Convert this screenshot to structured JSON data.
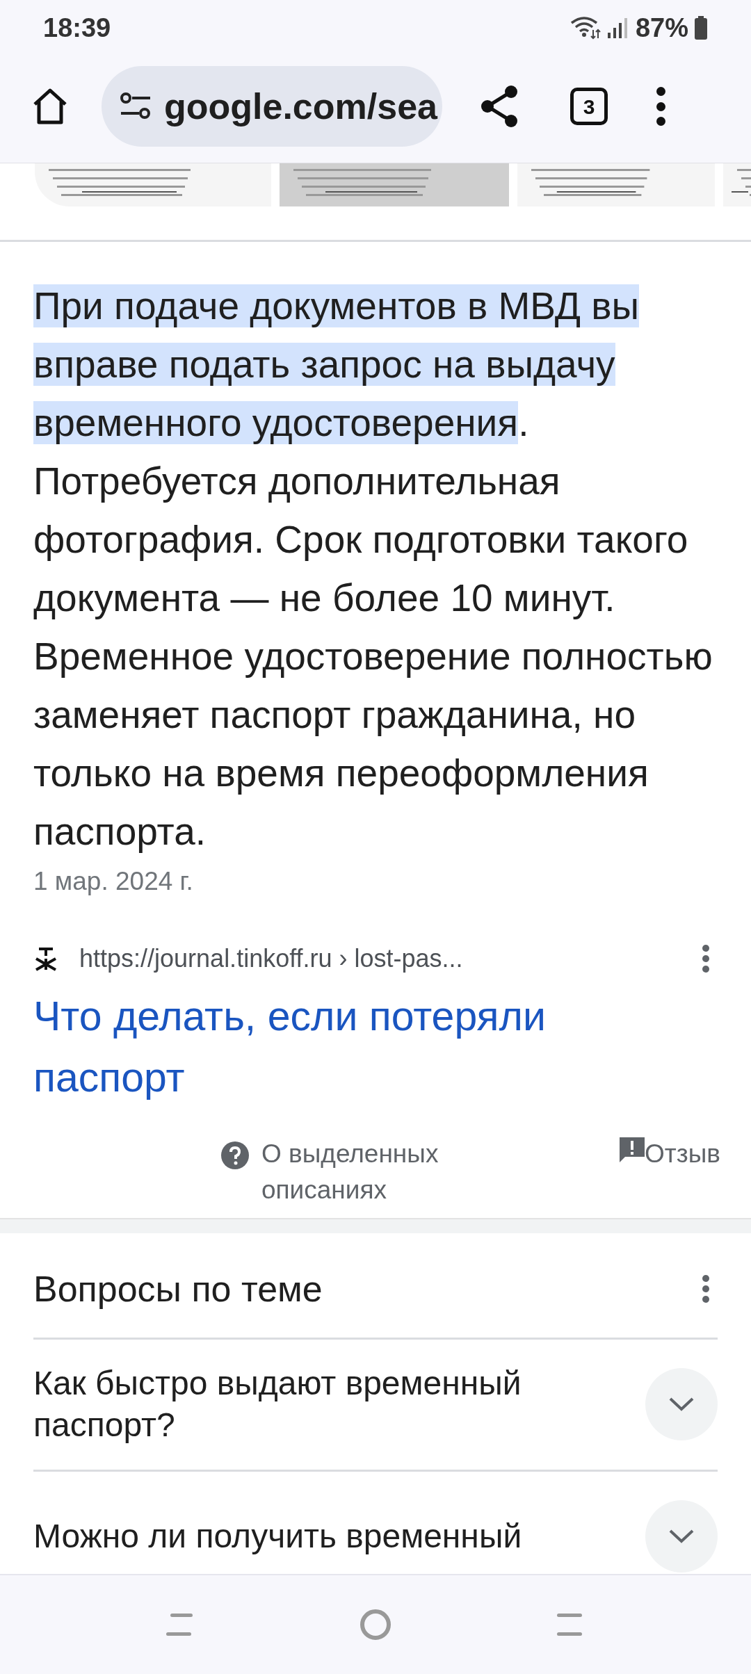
{
  "status_bar": {
    "time": "18:39",
    "battery": "87%"
  },
  "toolbar": {
    "url": "google.com/sea",
    "tab_count": "3"
  },
  "featured_snippet": {
    "highlight": "При подаче документов в МВД вы вправе подать запрос на выдачу временного удостоверения",
    "text": ". Потребуется дополнительная фотография. Срок подготовки такого документа — не более 10 минут. Временное удостоверение полностью заменяет паспорт гражданина, но только на время переоформления паспорта.",
    "date": "1 мар. 2024 г.",
    "source_url": "https://journal.tinkoff.ru › lost-pas...",
    "title": "Что делать, если потеряли паспорт",
    "about": "О выделенных описаниях",
    "feedback": "Отзыв"
  },
  "related_questions": {
    "title": "Вопросы по теме",
    "items": [
      {
        "question": "Как быстро выдают временный паспорт?",
        "expanded": false
      },
      {
        "question": "Можно ли получить временный",
        "expanded": false
      }
    ]
  }
}
